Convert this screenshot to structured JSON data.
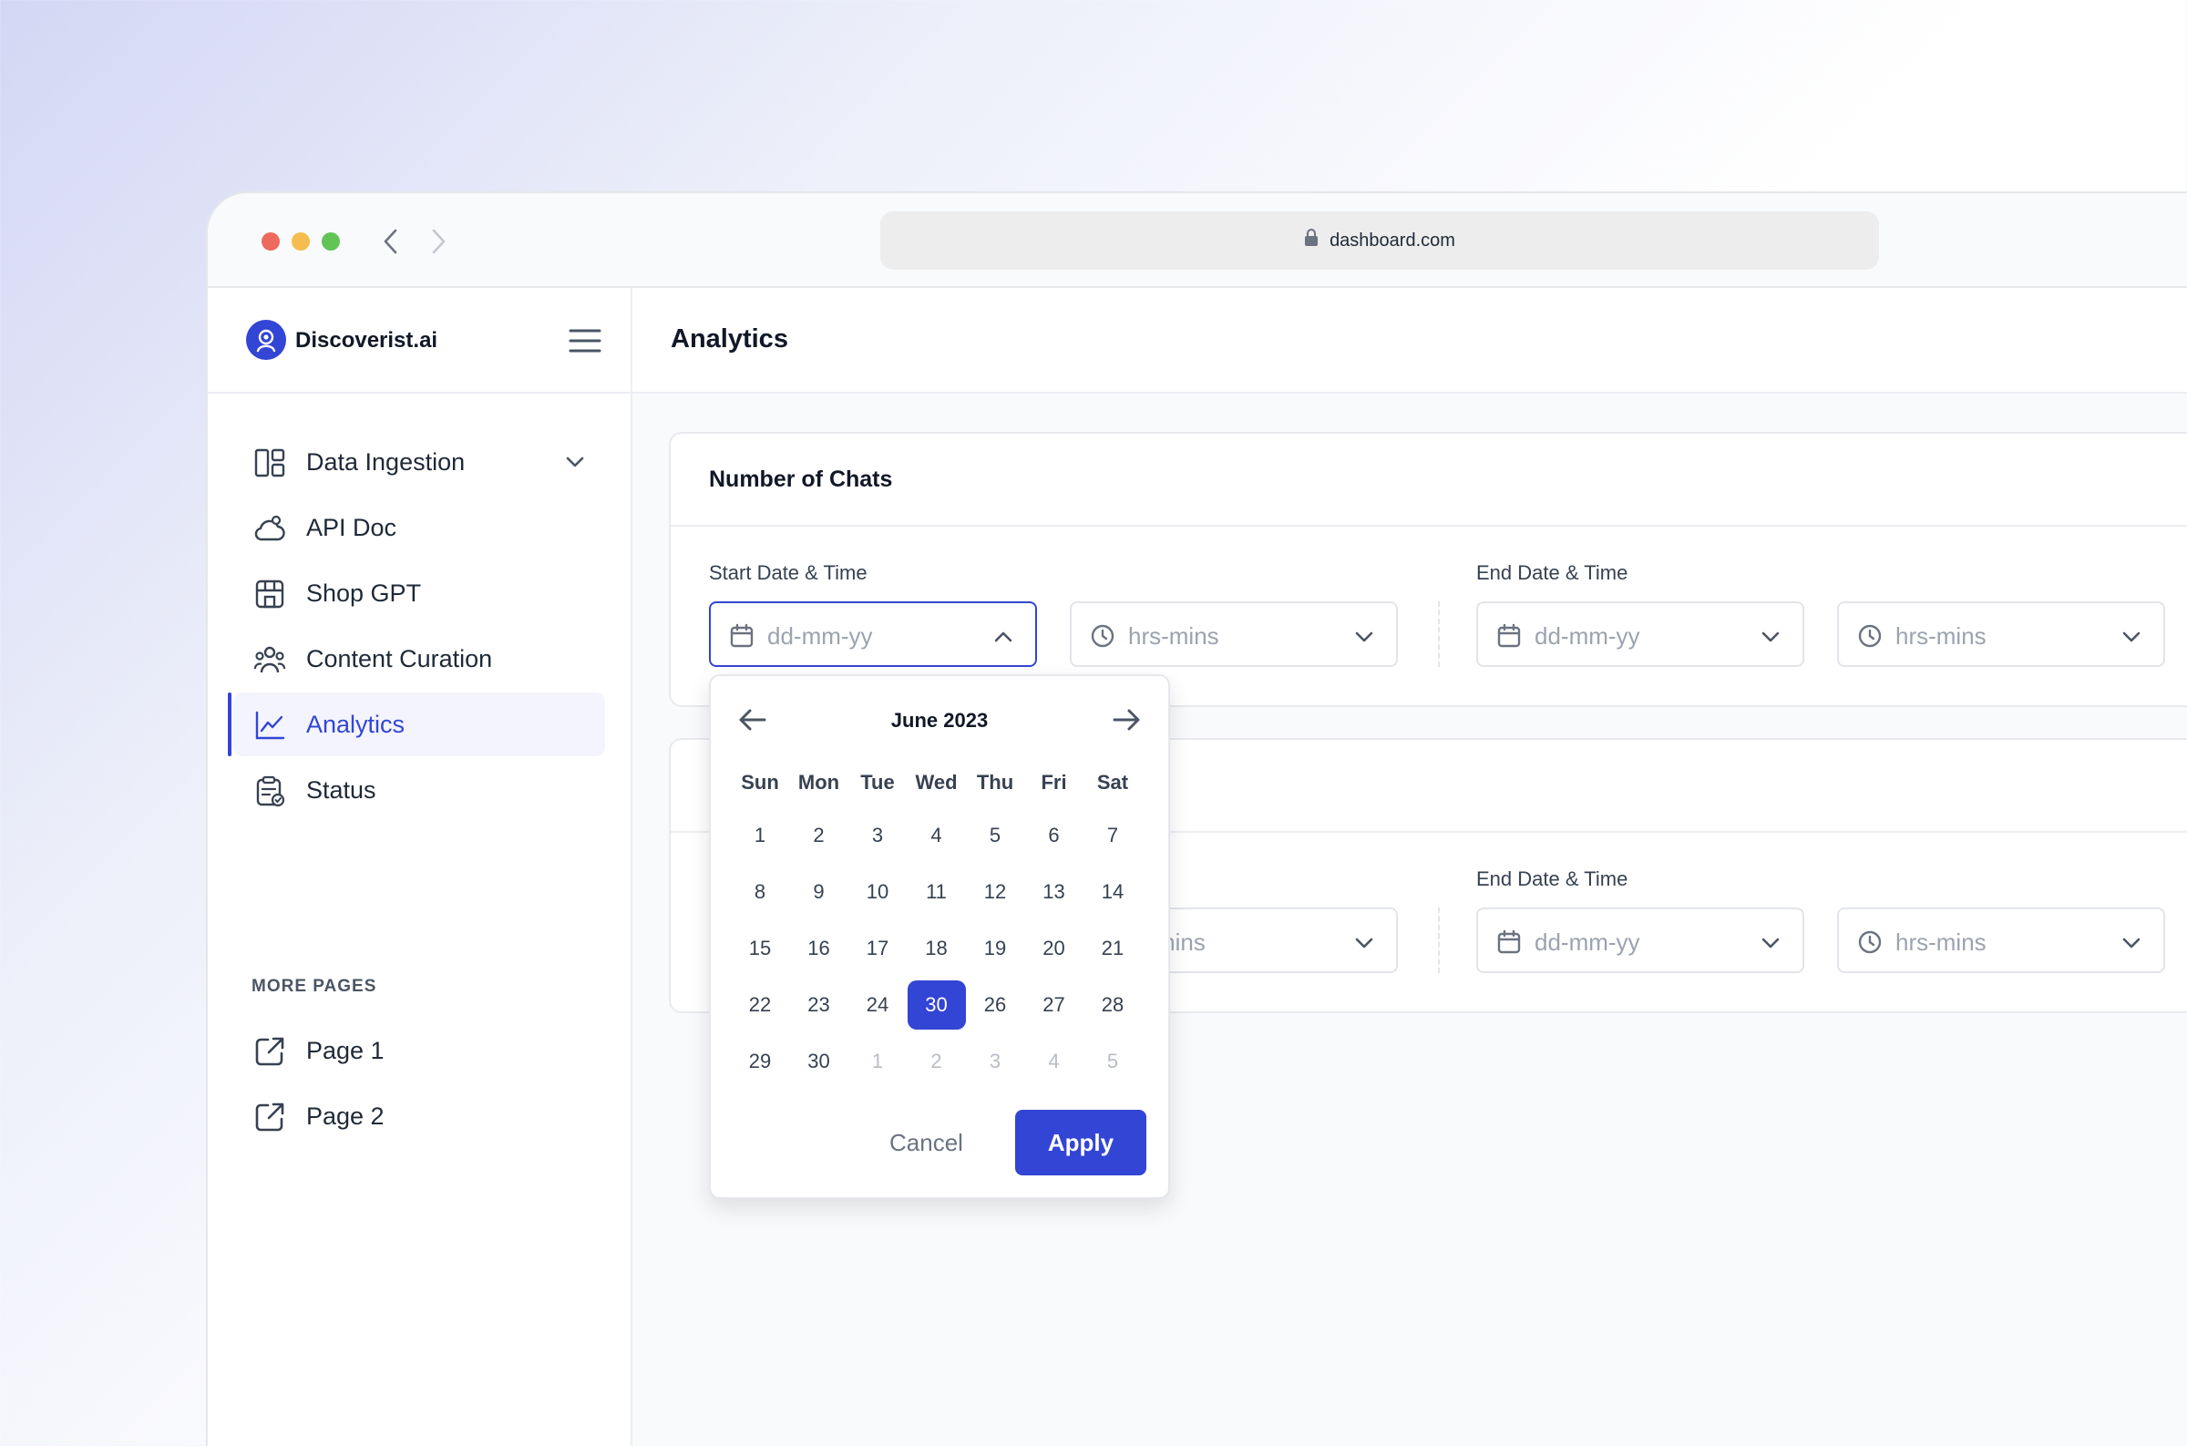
{
  "browser": {
    "url": "dashboard.com"
  },
  "sidebar": {
    "brand": "Discoverist.ai",
    "items": [
      {
        "label": "Data Ingestion",
        "icon": "layout-icon",
        "has_submenu": true
      },
      {
        "label": "API Doc",
        "icon": "cloud-gear-icon"
      },
      {
        "label": "Shop GPT",
        "icon": "store-icon"
      },
      {
        "label": "Content Curation",
        "icon": "users-icon"
      },
      {
        "label": "Analytics",
        "icon": "chart-line-icon",
        "active": true
      },
      {
        "label": "Status",
        "icon": "clipboard-check-icon"
      }
    ],
    "more_title": "MORE PAGES",
    "more_items": [
      {
        "label": "Page 1",
        "icon": "external-link-icon"
      },
      {
        "label": "Page 2",
        "icon": "external-link-icon"
      }
    ]
  },
  "header": {
    "title": "Analytics"
  },
  "cards": [
    {
      "title": "Number of Chats",
      "start_label": "Start Date & Time",
      "end_label": "End Date & Time",
      "date_placeholder": "dd-mm-yy",
      "time_placeholder": "hrs-mins"
    },
    {
      "end_label": "End Date & Time",
      "date_placeholder": "dd-mm-yy",
      "time_placeholder": "hrs-mins",
      "time_partial": "mins"
    }
  ],
  "datepicker": {
    "month": "June 2023",
    "weekdays": [
      "Sun",
      "Mon",
      "Tue",
      "Wed",
      "Thu",
      "Fri",
      "Sat"
    ],
    "weeks": [
      [
        "1",
        "2",
        "3",
        "4",
        "5",
        "6",
        "7"
      ],
      [
        "8",
        "9",
        "10",
        "11",
        "12",
        "13",
        "14"
      ],
      [
        "15",
        "16",
        "17",
        "18",
        "19",
        "20",
        "21"
      ],
      [
        "22",
        "23",
        "24",
        "30",
        "26",
        "27",
        "28"
      ],
      [
        "29",
        "30",
        "1",
        "2",
        "3",
        "4",
        "5"
      ]
    ],
    "selected": "30",
    "cancel": "Cancel",
    "apply": "Apply"
  },
  "colors": {
    "accent": "#3345d4",
    "text": "#111827",
    "muted": "#9ca3af"
  }
}
